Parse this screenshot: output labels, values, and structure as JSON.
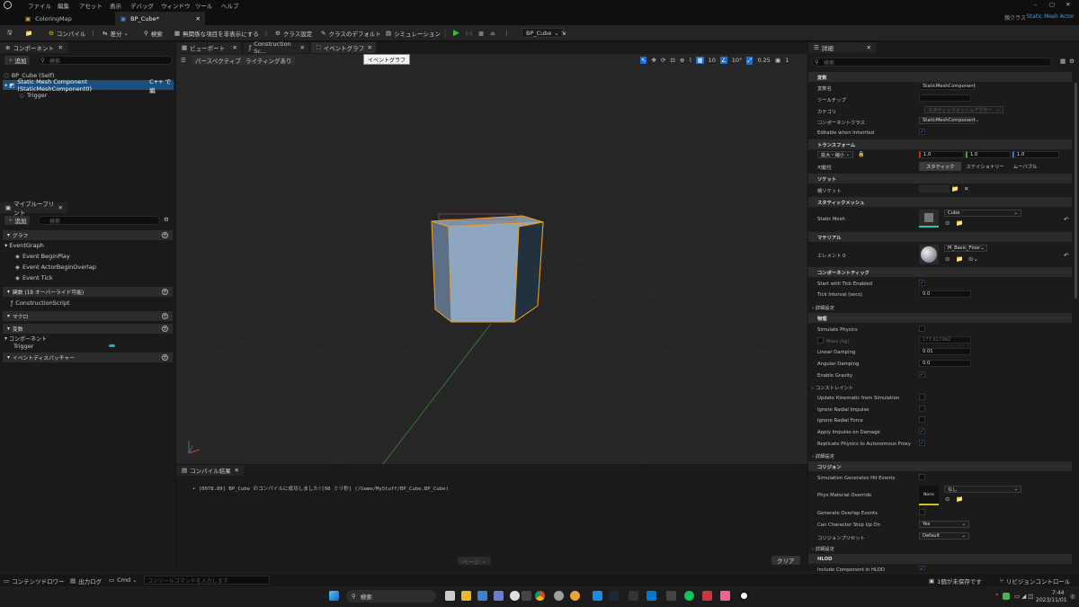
{
  "menu": [
    "ファイル",
    "編集",
    "アセット",
    "表示",
    "デバッグ",
    "ウィンドウ",
    "ツール",
    "ヘルプ"
  ],
  "window_controls": {
    "min": "–",
    "max": "▢",
    "close": "✕"
  },
  "parent_class": {
    "label": "親クラス",
    "value": "Static Mesh Actor"
  },
  "doc_tabs": [
    {
      "label": "ColoringMap"
    },
    {
      "label": "BP_Cube*"
    }
  ],
  "toolbar": {
    "compile": "コンパイル",
    "diff": "差分",
    "search": "検索",
    "hide_unrelated": "無関係な項目を非表示にする",
    "class_settings": "クラス設定",
    "class_defaults": "クラスのデフォルト",
    "simulation": "シミュレーション",
    "debug_object": "BP_Cube"
  },
  "components_panel": {
    "tab": "コンポーネント",
    "add": "追加",
    "search_placeholder": "検索",
    "items": [
      "BP_Cube (Self)",
      "Static Mesh Component (StaticMeshComponent0)",
      "C++ で編",
      "Trigger"
    ]
  },
  "my_blueprint": {
    "tab": "マイブループリント",
    "add": "追加",
    "search_placeholder": "検索",
    "graph_section": "グラフ",
    "event_graph": "EventGraph",
    "events": [
      "Event BeginPlay",
      "Event ActorBeginOverlap",
      "Event Tick"
    ],
    "functions_section": "関数 (19 オーバーライド可能)",
    "construction": "ConstructionScript",
    "macros_section": "マクロ",
    "variables_section": "変数",
    "components_cat": "コンポーネント",
    "trigger_var": "Trigger",
    "dispatchers_section": "イベントディスパッチャー"
  },
  "editor_tabs": [
    {
      "label": "ビューポート"
    },
    {
      "label": "Construction Sc..."
    },
    {
      "label": "イベントグラフ"
    }
  ],
  "tooltip": "イベントグラフ",
  "viewport": {
    "perspective": "パースペクティブ",
    "lighting": "ライティングあり",
    "grid_snap": "10",
    "rot_snap": "10°",
    "scale_snap": "0.25",
    "cam_speed": "1"
  },
  "compile_results": {
    "tab": "コンパイル結果",
    "log": "• [0078.89] BP_Cube のコンパイルに成功しました![98 ミリ秒] (/Game/MyStuff/BP_Cube.BP_Cube)",
    "page": "ページ",
    "clear": "クリア"
  },
  "details": {
    "tab": "詳細",
    "search_placeholder": "検索",
    "sec_variable": "変数",
    "var_name_label": "変数名",
    "var_name": "StaticMeshComponent",
    "tooltip_label": "ツールチップ",
    "category_label": "カテゴリ",
    "category": "スタティックメッシュアクター",
    "comp_class_label": "コンポーネントクラス",
    "comp_class": "StaticMeshComponent",
    "editable_inherited": "Editable when Inherited",
    "sec_transform": "トランスフォーム",
    "scale_label": "拡大・縮小",
    "scale_x": "1.0",
    "scale_y": "1.0",
    "scale_z": "1.0",
    "mobility_label": "可動性",
    "mobility": [
      "スタティック",
      "ステイショナリー",
      "ムーバブル"
    ],
    "sec_sockets": "ソケット",
    "parent_socket": "親ソケット",
    "sec_static_mesh": "スタティックメッシュ",
    "static_mesh_label": "Static Mesh",
    "static_mesh": "Cube",
    "sec_materials": "マテリアル",
    "element0_label": "エレメント 0",
    "element0": "M_Basic_Floor",
    "sec_comp_tick": "コンポーネントティック",
    "start_tick": "Start with Tick Enabled",
    "tick_interval_label": "Tick Interval (secs)",
    "tick_interval": "0.0",
    "advanced": "詳細設定",
    "sec_physics": "物理",
    "simulate_physics": "Simulate Physics",
    "mass_label": "Mass (kg)",
    "mass": "177.827942",
    "linear_damping_label": "Linear Damping",
    "linear_damping": "0.01",
    "angular_damping_label": "Angular Damping",
    "angular_damping": "0.0",
    "enable_gravity": "Enable Gravity",
    "constraints": "コンストレイント",
    "update_kinematic": "Update Kinematic from Simulation",
    "ignore_radial_impulse": "Ignore Radial Impulse",
    "ignore_radial_force": "Ignore Radial Force",
    "apply_impulse": "Apply Impulse on Damage",
    "replicate_physics": "Replicate Physics to Autonomous Proxy",
    "sec_collision": "コリジョン",
    "sim_hit_events": "Simulation Generates Hit Events",
    "phys_mat_label": "Phys Material Override",
    "phys_mat_none": "None",
    "phys_mat_value": "なし",
    "gen_overlap": "Generate Overlap Events",
    "step_up_label": "Can Character Step Up On",
    "step_up": "Yes",
    "collision_preset_label": "コリジョンプリセット",
    "collision_preset": "Default",
    "sec_hlod": "HLOD",
    "include_hlod": "Include Component in HLOD"
  },
  "statusbar": {
    "content_drawer": "コンテンツドロワー",
    "output_log": "出力ログ",
    "cmd": "Cmd",
    "console_placeholder": "コンソールコマンドを入力します",
    "unsaved": "1個が未保存です",
    "source_control": "リビジョンコントロール"
  },
  "taskbar": {
    "search": "検索",
    "time": "7:44",
    "date": "2023/11/01"
  }
}
